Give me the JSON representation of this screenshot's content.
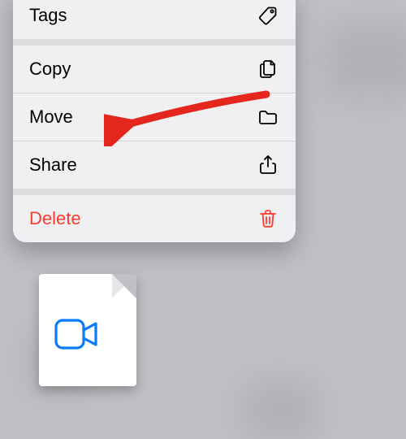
{
  "menu": {
    "items": [
      {
        "label": "Tags",
        "icon": "tag-icon",
        "danger": false,
        "thickSep": false
      },
      {
        "label": "Copy",
        "icon": "copy-icon",
        "danger": false,
        "thickSep": true
      },
      {
        "label": "Move",
        "icon": "folder-icon",
        "danger": false,
        "thickSep": false
      },
      {
        "label": "Share",
        "icon": "share-icon",
        "danger": false,
        "thickSep": false
      },
      {
        "label": "Delete",
        "icon": "trash-icon",
        "danger": true,
        "thickSep": true
      }
    ]
  },
  "annotation": {
    "arrow_points_to": "Move"
  },
  "preview": {
    "type": "video-file",
    "icon": "video-icon"
  }
}
